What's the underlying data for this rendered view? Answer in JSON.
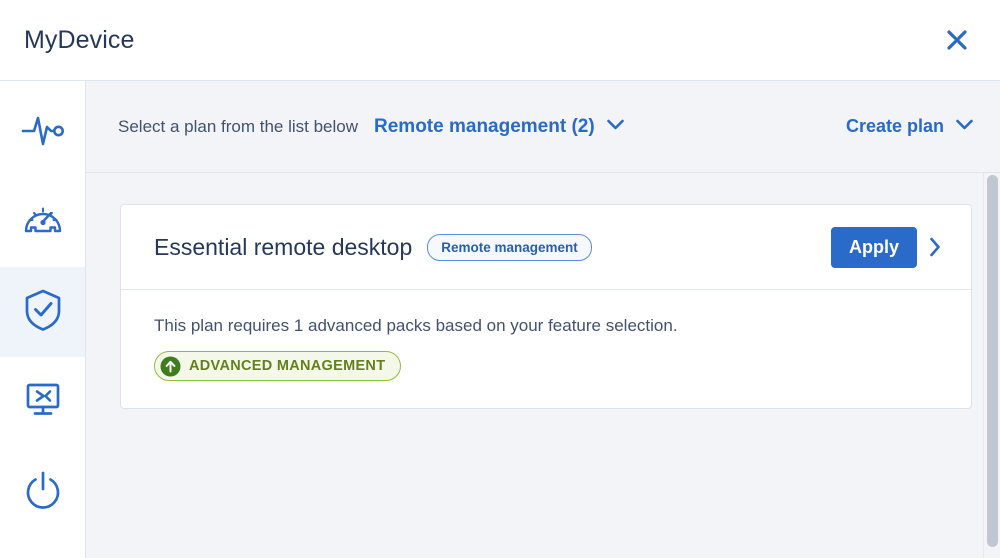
{
  "window": {
    "title": "MyDevice",
    "close_icon": "close-x-icon"
  },
  "sidebar": {
    "items": [
      {
        "id": "monitoring",
        "icon": "pulse-heartbeat-icon",
        "active": false
      },
      {
        "id": "performance",
        "icon": "gauge-speedometer-icon",
        "active": false
      },
      {
        "id": "security",
        "icon": "shield-check-icon",
        "active": true
      },
      {
        "id": "remote-desktop",
        "icon": "monitor-remote-icon",
        "active": false
      },
      {
        "id": "power",
        "icon": "power-icon",
        "active": false
      }
    ]
  },
  "toolbar": {
    "instruction": "Select a plan from the list below",
    "plan_filter": {
      "label": "Remote management (2)",
      "chevron_icon": "chevron-down-icon"
    },
    "create_plan": {
      "label": "Create plan",
      "chevron_icon": "chevron-down-icon"
    }
  },
  "plan_card": {
    "title": "Essential remote desktop",
    "category_badge": "Remote management",
    "apply_label": "Apply",
    "expand_icon": "chevron-right-icon",
    "description": "This plan requires 1 advanced packs based on your feature selection.",
    "pack_badge": {
      "label": "ADVANCED MANAGEMENT",
      "icon": "arrow-up-circle-icon"
    }
  },
  "colors": {
    "accent_blue": "#2a6ac9",
    "title_navy": "#253858",
    "badge_green": "#64801e",
    "content_bg": "#f2f4f7"
  }
}
